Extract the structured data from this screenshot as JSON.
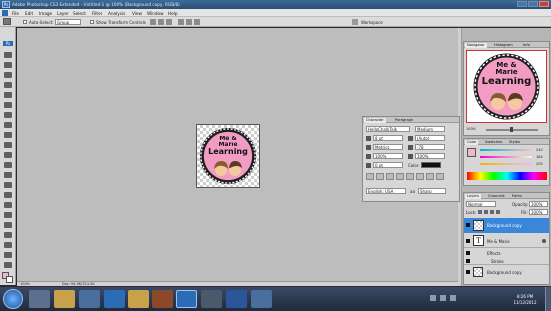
{
  "window": {
    "title": "Adobe Photoshop CS3 Extended - Untitled-1 @ 100% (Background copy, RGB/8)",
    "app_badge": "Ps"
  },
  "menu": [
    "File",
    "Edit",
    "Image",
    "Layer",
    "Select",
    "Filter",
    "Analysis",
    "View",
    "Window",
    "Help"
  ],
  "options": {
    "auto_select_label": "Auto-Select:",
    "auto_select_value": "Group",
    "transform_label": "Show Transform Controls",
    "workspace_label": "Workspace"
  },
  "document": {
    "logo_line1": "Me &",
    "logo_line2": "Marie",
    "logo_line3": "Learning",
    "status_zoom": "100%",
    "status_doc": "Doc: 94.9K/314.0K"
  },
  "navigator": {
    "tabs": [
      "Navigator",
      "Histogram",
      "Info"
    ],
    "zoom": "100%"
  },
  "character": {
    "tabs": [
      "Character",
      "Paragraph"
    ],
    "font_family": "HelloChalkTalk",
    "font_style": "Medium",
    "font_size": "8 pt",
    "leading": "(Auto)",
    "kerning": "Metrics",
    "tracking": "-78",
    "vscale": "100%",
    "hscale": "100%",
    "baseline": "0 pt",
    "color_label": "Color:",
    "language": "English: USA",
    "aa_label": "aa",
    "antialias": "Sharp"
  },
  "color": {
    "tabs": [
      "Color",
      "Swatches",
      "Styles"
    ],
    "r": "240",
    "g": "184",
    "b": "205",
    "fg_color": "#f0b8cd"
  },
  "layers": {
    "tabs": [
      "Layers",
      "Channels",
      "Paths"
    ],
    "blend_mode": "Normal",
    "opacity_label": "Opacity:",
    "opacity": "100%",
    "lock_label": "Lock:",
    "fill_label": "Fill:",
    "fill": "100%",
    "items": [
      {
        "name": "Background copy",
        "selected": true
      },
      {
        "name": "Me & Marie",
        "selected": false
      },
      {
        "name": "Effects",
        "selected": false
      },
      {
        "name": "Stroke",
        "selected": false
      },
      {
        "name": "Background copy",
        "selected": false
      }
    ]
  },
  "taskbar": {
    "time": "8:26 PM",
    "date": "11/12/2012"
  }
}
